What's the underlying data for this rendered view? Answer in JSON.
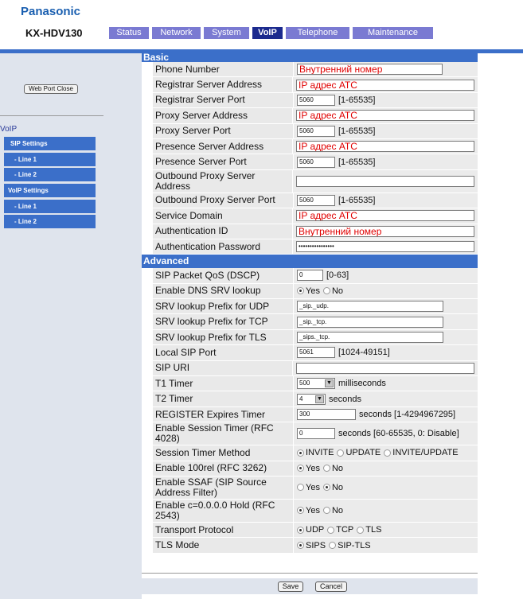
{
  "header": {
    "brand": "Panasonic",
    "model": "KX-HDV130"
  },
  "tabs": [
    {
      "label": "Status"
    },
    {
      "label": "Network"
    },
    {
      "label": "System"
    },
    {
      "label": "VoIP"
    },
    {
      "label": "Telephone"
    },
    {
      "label": "Maintenance"
    }
  ],
  "sidebar": {
    "web_port_close": "Web Port Close",
    "heading": "VoIP",
    "items": [
      {
        "label": "SIP Settings"
      },
      {
        "label": "- Line 1"
      },
      {
        "label": "- Line 2"
      },
      {
        "label": "VoIP Settings"
      },
      {
        "label": "- Line 1"
      },
      {
        "label": "- Line 2"
      }
    ]
  },
  "basic": {
    "title": "Basic",
    "rows": [
      {
        "label": "Phone Number",
        "value": "Внутренний номер"
      },
      {
        "label": "Registrar Server Address",
        "value": "IP адрес АТС"
      },
      {
        "label": "Registrar Server Port",
        "value": "5060",
        "range": "[1-65535]"
      },
      {
        "label": "Proxy Server Address",
        "value": "IP адрес АТС"
      },
      {
        "label": "Proxy Server Port",
        "value": "5060",
        "range": "[1-65535]"
      },
      {
        "label": "Presence Server Address",
        "value": "IP адрес АТС"
      },
      {
        "label": "Presence Server Port",
        "value": "5060",
        "range": "[1-65535]"
      },
      {
        "label": "Outbound Proxy Server Address",
        "value": ""
      },
      {
        "label": "Outbound Proxy Server Port",
        "value": "5060",
        "range": "[1-65535]"
      },
      {
        "label": "Service Domain",
        "value": "IP адрес АТС"
      },
      {
        "label": "Authentication ID",
        "value": "Внутренний номер"
      },
      {
        "label": "Authentication Password",
        "value": "••••••••••••••••"
      }
    ]
  },
  "advanced": {
    "title": "Advanced",
    "rows": [
      {
        "label": "SIP Packet QoS (DSCP)",
        "value": "0",
        "range": "[0-63]"
      },
      {
        "label": "Enable DNS SRV lookup",
        "options": [
          "Yes",
          "No"
        ],
        "selected": "Yes"
      },
      {
        "label": "SRV lookup Prefix for UDP",
        "value": "_sip._udp."
      },
      {
        "label": "SRV lookup Prefix for TCP",
        "value": "_sip._tcp."
      },
      {
        "label": "SRV lookup Prefix for TLS",
        "value": "_sips._tcp."
      },
      {
        "label": "Local SIP Port",
        "value": "5061",
        "range": "[1024-49151]"
      },
      {
        "label": "SIP URI",
        "value": ""
      },
      {
        "label": "T1 Timer",
        "value": "500",
        "unit": "milliseconds"
      },
      {
        "label": "T2 Timer",
        "value": "4",
        "unit": "seconds"
      },
      {
        "label": "REGISTER Expires Timer",
        "value": "300",
        "range": "seconds [1-4294967295]"
      },
      {
        "label": "Enable Session Timer (RFC 4028)",
        "value": "0",
        "range": "seconds [60-65535, 0: Disable]"
      },
      {
        "label": "Session Timer Method",
        "options": [
          "INVITE",
          "UPDATE",
          "INVITE/UPDATE"
        ],
        "selected": "INVITE"
      },
      {
        "label": "Enable 100rel (RFC 3262)",
        "options": [
          "Yes",
          "No"
        ],
        "selected": "Yes"
      },
      {
        "label": "Enable SSAF (SIP Source Address Filter)",
        "options": [
          "Yes",
          "No"
        ],
        "selected": "No"
      },
      {
        "label": "Enable c=0.0.0.0 Hold (RFC 2543)",
        "options": [
          "Yes",
          "No"
        ],
        "selected": "Yes"
      },
      {
        "label": "Transport Protocol",
        "options": [
          "UDP",
          "TCP",
          "TLS"
        ],
        "selected": "UDP"
      },
      {
        "label": "TLS Mode",
        "options": [
          "SIPS",
          "SIP-TLS"
        ],
        "selected": "SIPS"
      }
    ]
  },
  "buttons": {
    "save": "Save",
    "cancel": "Cancel"
  }
}
